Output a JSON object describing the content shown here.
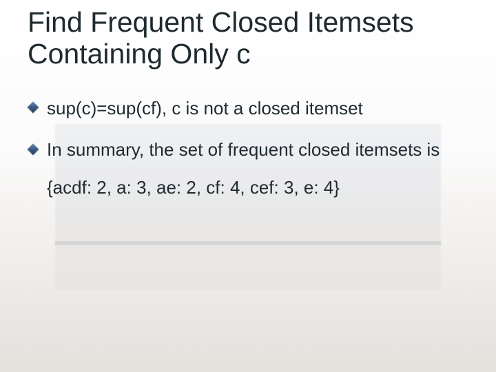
{
  "title": "Find Frequent Closed Itemsets Containing Only c",
  "bullets": [
    {
      "text": "sup(c)=sup(cf), c is not a closed itemset"
    },
    {
      "text": "In summary, the set of frequent closed itemsets is {acdf: 2, a: 3, ae: 2, cf: 4, cef: 3, e: 4}"
    }
  ]
}
